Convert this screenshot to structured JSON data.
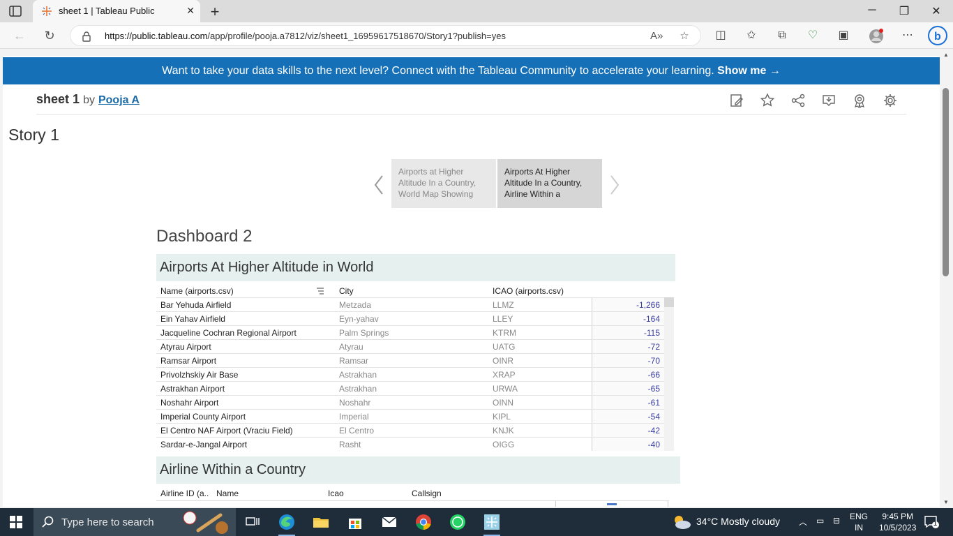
{
  "browser": {
    "tab_title": "sheet 1 | Tableau Public",
    "url_host": "https://public.tableau.com",
    "url_path": "/app/profile/pooja.a7812/viz/sheet1_16959617518670/Story1?publish=yes"
  },
  "promo": {
    "text": "Want to take your data skills to the next level? Connect with the Tableau Community to accelerate your learning.",
    "link": "Show me →"
  },
  "viz": {
    "title": "sheet 1",
    "by": "by",
    "author": "Pooja A"
  },
  "story": {
    "title": "Story 1",
    "points": [
      "Airports at Higher Altitude In a Country, World Map Showing",
      "Airports At Higher Altitude In a Country, Airline Within a"
    ]
  },
  "dashboard": {
    "title": "Dashboard 2",
    "sheet1": {
      "title": "Airports At Higher Altitude in World",
      "columns": [
        "Name (airports.csv)",
        "City",
        "ICAO (airports.csv)"
      ],
      "rows": [
        {
          "name": "Bar Yehuda Airfield",
          "city": "Metzada",
          "icao": "LLMZ",
          "value": "-1,266"
        },
        {
          "name": "Ein Yahav Airfield",
          "city": "Eyn-yahav",
          "icao": "LLEY",
          "value": "-164"
        },
        {
          "name": "Jacqueline Cochran Regional Airport",
          "city": "Palm Springs",
          "icao": "KTRM",
          "value": "-115"
        },
        {
          "name": "Atyrau Airport",
          "city": "Atyrau",
          "icao": "UATG",
          "value": "-72"
        },
        {
          "name": "Ramsar Airport",
          "city": "Ramsar",
          "icao": "OINR",
          "value": "-70"
        },
        {
          "name": "Privolzhskiy Air Base",
          "city": "Astrakhan",
          "icao": "XRAP",
          "value": "-66"
        },
        {
          "name": "Astrakhan Airport",
          "city": "Astrakhan",
          "icao": "URWA",
          "value": "-65"
        },
        {
          "name": "Noshahr Airport",
          "city": "Noshahr",
          "icao": "OINN",
          "value": "-61"
        },
        {
          "name": "Imperial County Airport",
          "city": "Imperial",
          "icao": "KIPL",
          "value": "-54"
        },
        {
          "name": "El Centro NAF Airport (Vraciu Field)",
          "city": "El Centro",
          "icao": "KNJK",
          "value": "-42"
        },
        {
          "name": "Sardar-e-Jangal Airport",
          "city": "Rasht",
          "icao": "OIGG",
          "value": "-40"
        }
      ]
    },
    "sheet2": {
      "title": "Airline Within a Country",
      "columns": [
        "Airline ID (a..",
        "Name",
        "Icao",
        "Callsign"
      ]
    }
  },
  "taskbar": {
    "search_placeholder": "Type here to search",
    "weather": "34°C  Mostly cloudy",
    "lang1": "ENG",
    "lang2": "IN",
    "time": "9:45 PM",
    "date": "10/5/2023",
    "notifications": "1"
  },
  "colors": {
    "promo": "#1570b8",
    "band": "#e6f1ef",
    "value_text": "#3a3fa0",
    "taskbar": "#1f2d3a"
  }
}
